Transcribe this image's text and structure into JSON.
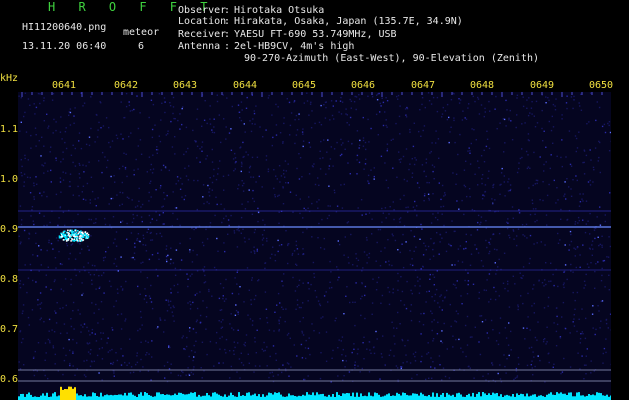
{
  "header": {
    "brand": "H R O F F T",
    "filename": "HI11200640.png",
    "timestamp": "13.11.20 06:40",
    "meteor_label": "meteor",
    "meteor_count": "6"
  },
  "info": [
    {
      "label": "Observer",
      "value": "Hirotaka Otsuka"
    },
    {
      "label": "Location",
      "value": "Hirakata, Osaka, Japan (135.7E, 34.9N)"
    },
    {
      "label": "Receiver",
      "value": "YAESU FT-690 53.749MHz, USB"
    },
    {
      "label": "Antenna",
      "value": "2el-HB9CV, 4m's high"
    },
    {
      "label": "",
      "value": "90-270-Azimuth (East-West), 90-Elevation (Zenith)"
    }
  ],
  "axis": {
    "y_unit": "kHz",
    "y_ticks": [
      "1.1",
      "1.0",
      "0.9",
      "0.8",
      "0.7",
      "0.6"
    ],
    "x_ticks": [
      "0641",
      "0642",
      "0643",
      "0644",
      "0645",
      "0646",
      "0647",
      "0648",
      "0649",
      "0650"
    ]
  },
  "colors": {
    "background": "#000000",
    "noise": "#1a1a6e",
    "carrier": "#6b8cff",
    "signal": "#00e5ff",
    "tick": "#f0e040",
    "text": "#e8e8e8",
    "brand": "#3fd23f"
  }
}
